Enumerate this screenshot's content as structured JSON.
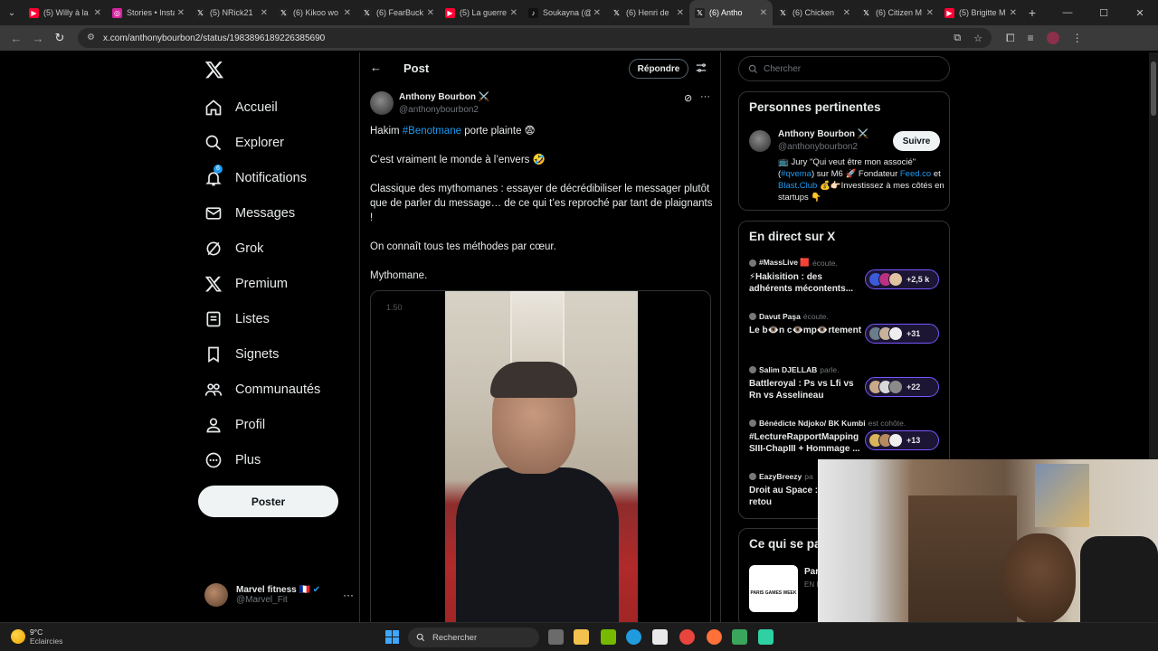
{
  "browser": {
    "tabs": [
      {
        "label": "(5) Willy à la",
        "icon": "youtube-icon",
        "color": "#ff0033"
      },
      {
        "label": "Stories • Insta",
        "icon": "instagram-icon",
        "color": "#d6249f"
      },
      {
        "label": "(5) NRick21",
        "icon": "x-icon",
        "color": "#222222"
      },
      {
        "label": "(6) Kikoo wo",
        "icon": "x-icon",
        "color": "#222222"
      },
      {
        "label": "(6) FearBuck",
        "icon": "x-icon",
        "color": "#222222"
      },
      {
        "label": "(5) La guerre",
        "icon": "youtube-icon",
        "color": "#ff0033"
      },
      {
        "label": "Soukayna (@",
        "icon": "tiktok-icon",
        "color": "#111111"
      },
      {
        "label": "(6) Henri de",
        "icon": "x-icon",
        "color": "#222222"
      },
      {
        "label": "(6) Antho",
        "icon": "x-icon",
        "color": "#222222",
        "active": true
      },
      {
        "label": "(6) Chicken",
        "icon": "x-icon",
        "color": "#222222"
      },
      {
        "label": "(6) Citizen M",
        "icon": "x-icon",
        "color": "#222222"
      },
      {
        "label": "(5) Brigitte M",
        "icon": "youtube-icon",
        "color": "#ff0033"
      }
    ],
    "url": "x.com/anthonybourbon2/status/1983896189226385690"
  },
  "nav": {
    "items": [
      {
        "label": "Accueil",
        "icon": "home-icon"
      },
      {
        "label": "Explorer",
        "icon": "search-icon"
      },
      {
        "label": "Notifications",
        "icon": "bell-icon",
        "badge": "6"
      },
      {
        "label": "Messages",
        "icon": "mail-icon"
      },
      {
        "label": "Grok",
        "icon": "grok-icon"
      },
      {
        "label": "Premium",
        "icon": "x-icon"
      },
      {
        "label": "Listes",
        "icon": "list-icon"
      },
      {
        "label": "Signets",
        "icon": "bookmark-icon"
      },
      {
        "label": "Communautés",
        "icon": "communities-icon"
      },
      {
        "label": "Profil",
        "icon": "profile-icon"
      },
      {
        "label": "Plus",
        "icon": "more-circle-icon"
      }
    ],
    "post_button": "Poster",
    "account": {
      "name": "Marvel fitness 🇫🇷",
      "handle": "@Marvel_Fit"
    }
  },
  "post": {
    "header_title": "Post",
    "reply_button": "Répondre",
    "author_name": "Anthony Bourbon ⚔️",
    "author_handle": "@anthonybourbon2",
    "line1_prefix": "Hakim ",
    "line1_hashtag": "#Benotmane",
    "line1_suffix": " porte plainte 😨",
    "line2": "C’est vraiment le monde à l’envers 🤣",
    "line3": "Classique des mythomanes : essayer de décrédibiliser le messager plutôt que de parler du message… de ce qui t’es reproché par tant de plaignants !",
    "line4": "On connaît tous tes méthodes par cœur.",
    "line5": "Mythomane.",
    "video_speed": "1.50"
  },
  "sidebar": {
    "search_placeholder": "Chercher",
    "relevant": {
      "title": "Personnes pertinentes",
      "name": "Anthony Bourbon ⚔️",
      "handle": "@anthonybourbon2",
      "follow": "Suivre",
      "bio_1": "📺 Jury \"Qui veut être mon associé\" (",
      "bio_tag": "#qvema",
      "bio_2": ") sur M6 🚀 Fondateur ",
      "bio_link1": "Feed.co",
      "bio_3": " et ",
      "bio_link2": "Blast.Club",
      "bio_4": " 💰👉🏻Investissez à mes côtés en startups 👇"
    },
    "live": {
      "title": "En direct sur X",
      "spaces": [
        {
          "host": "#MassLive 🟥",
          "status": "écoute.",
          "title": "⚡Hakisition : des adhérents mécontents...",
          "count": "+2,5 k"
        },
        {
          "host": "Davut Paşa",
          "status": "écoute.",
          "title": "Le b👁️n c👁️mp👁️rtement",
          "count": "+31"
        },
        {
          "host": "Salim DJELLAB",
          "status": "parle.",
          "title": "Battleroyal : Ps vs Lfi vs Rn vs Asselineau",
          "count": "+22"
        },
        {
          "host": "Bénédicte Ndjoko/ BK Kumbi",
          "status": "est cohôte.",
          "title": "#LectureRapportMapping SIII-ChapIII + Hommage ...",
          "count": "+13"
        },
        {
          "host": "EazyBreezy",
          "status": "pa",
          "title": "Droit au Space : Épisode 9, retou",
          "count": ""
        }
      ]
    },
    "happening": {
      "title": "Ce qui se pa",
      "item_title": "Par",
      "item_sub": "EN D",
      "logo_text": "PARIS GAMES WEEK"
    }
  },
  "taskbar": {
    "temp": "9°C",
    "weather": "Eclaircies",
    "search": "Rechercher"
  },
  "colors": {
    "accent": "#1d9bf0",
    "live_purple": "#7856ff"
  }
}
